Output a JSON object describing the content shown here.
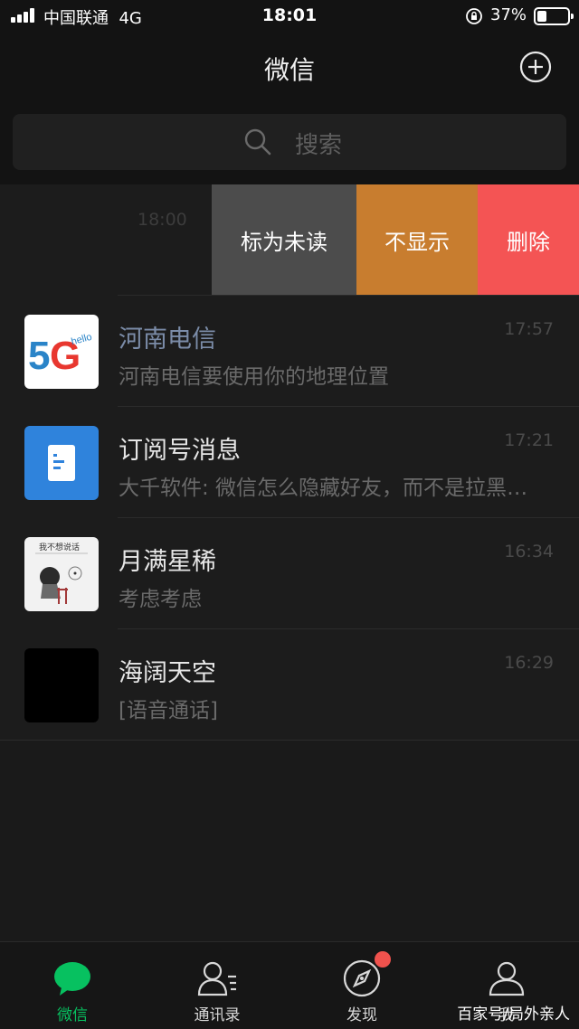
{
  "status_bar": {
    "carrier": "中国联通",
    "network": "4G",
    "time": "18:01",
    "battery": "37%"
  },
  "header": {
    "title": "微信",
    "add_icon": "plus-circle-icon"
  },
  "search": {
    "placeholder": "搜索",
    "icon": "search-icon"
  },
  "swiped_row": {
    "time": "18:00",
    "actions": {
      "mark_unread": "标为未读",
      "hide": "不显示",
      "delete": "删除"
    },
    "colors": {
      "mark_unread": "#4c4c4c",
      "hide": "#c87d2f",
      "delete": "#f45454"
    }
  },
  "chats": [
    {
      "name": "河南电信",
      "time": "17:57",
      "preview": "河南电信要使用你的地理位置",
      "avatar": "5g-hello-logo"
    },
    {
      "name": "订阅号消息",
      "time": "17:21",
      "preview": "大千软件: 微信怎么隐藏好友，而不是拉黑删除？",
      "avatar": "subscription-document-icon"
    },
    {
      "name": "月满星稀",
      "time": "16:34",
      "preview": "考虑考虑",
      "avatar": "sketch-photo"
    },
    {
      "name": "海阔天空",
      "time": "16:29",
      "preview": "[语音通话]",
      "avatar": "black-avatar"
    }
  ],
  "avatar_1_text": {
    "big": "5G",
    "small": "hello"
  },
  "avatar_3_text": "我不想说话",
  "tabs": [
    {
      "label": "微信",
      "icon": "chat-bubble-icon",
      "active": true
    },
    {
      "label": "通讯录",
      "icon": "contacts-icon",
      "active": false
    },
    {
      "label": "发现",
      "icon": "compass-icon",
      "active": false,
      "badge": true
    },
    {
      "label": "我",
      "icon": "person-icon",
      "active": false
    }
  ],
  "watermark": "百家号/局外亲人",
  "colors": {
    "accent": "#07c160",
    "badge": "#f0524d",
    "background": "#1a1a1a"
  }
}
